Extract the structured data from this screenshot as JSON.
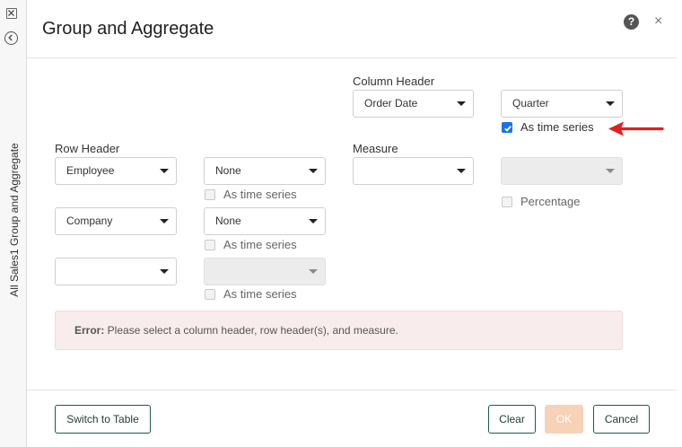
{
  "sidebar": {
    "vertical_title": "All Sales1 Group and Aggregate"
  },
  "dialog": {
    "title": "Group and Aggregate",
    "help_label": "?",
    "close_label": "×"
  },
  "column_header": {
    "label": "Column Header",
    "field_value": "Order Date",
    "interval_value": "Quarter",
    "time_series_label": "As time series",
    "time_series_checked": true
  },
  "row_header": {
    "label": "Row Header",
    "rows": [
      {
        "field_value": "Employee",
        "interval_value": "None",
        "time_series_label": "As time series"
      },
      {
        "field_value": "Company",
        "interval_value": "None",
        "time_series_label": "As time series"
      },
      {
        "field_value": "",
        "interval_value": "",
        "time_series_label": "As time series"
      }
    ]
  },
  "measure": {
    "label": "Measure",
    "field_value": "",
    "aggregate_value": "",
    "percentage_label": "Percentage"
  },
  "error": {
    "prefix": "Error:",
    "message": " Please select a column header, row header(s), and measure."
  },
  "footer": {
    "switch_label": "Switch to Table",
    "clear_label": "Clear",
    "ok_label": "OK",
    "cancel_label": "Cancel"
  },
  "colors": {
    "accent": "#1a73e8",
    "annotation_arrow": "#e02020",
    "button_border": "#1e5a4f",
    "ok_disabled": "#f7d2b6",
    "error_bg": "#f9eced"
  }
}
